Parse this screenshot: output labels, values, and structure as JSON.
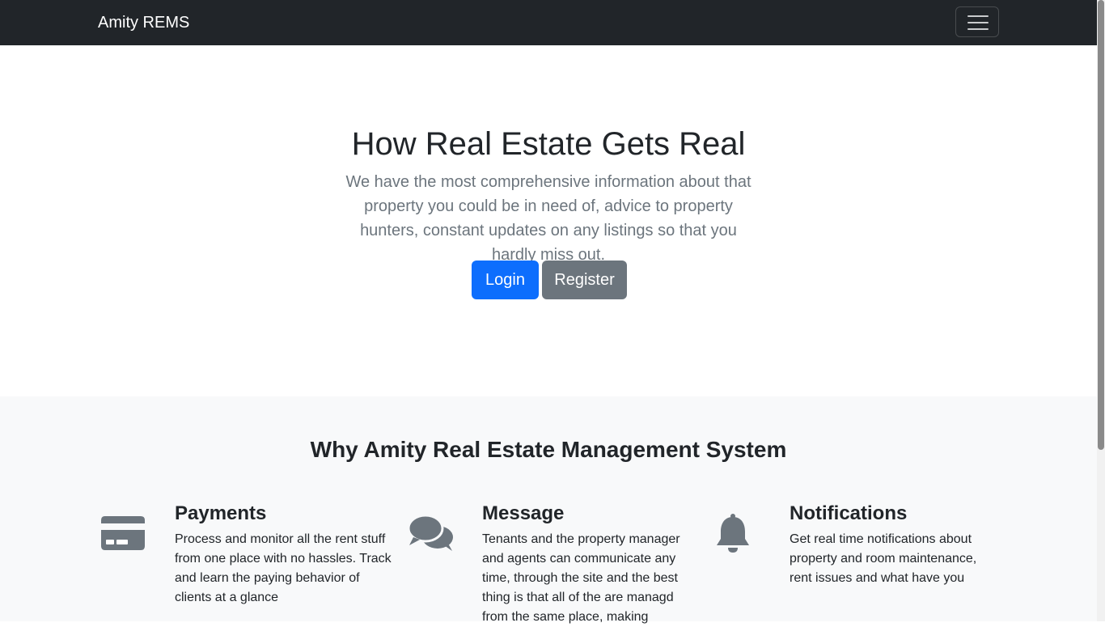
{
  "navbar": {
    "brand": "Amity REMS",
    "toggler_icon": "hamburger-menu-icon"
  },
  "hero": {
    "title": "How Real Estate Gets Real",
    "lead": "We have the most comprehensive information about that property you could be in need of, advice to property hunters, constant updates on any listings so that you hardly miss out.",
    "login_label": "Login",
    "register_label": "Register"
  },
  "features": {
    "heading": "Why Amity Real Estate Management System",
    "items": [
      {
        "icon": "credit-card-icon",
        "title": "Payments",
        "text": "Process and monitor all the rent stuff from one place with no hassles. Track and learn the paying behavior of clients at a glance"
      },
      {
        "icon": "chat-bubbles-icon",
        "title": "Message",
        "text": "Tenants and the property manager and agents can communicate any time, through the site and the best thing is that all of the are managd from the same place, making"
      },
      {
        "icon": "bell-icon",
        "title": "Notifications",
        "text": "Get real time notifications about property and room maintenance, rent issues and what have you"
      }
    ]
  },
  "colors": {
    "navbar_bg": "#212529",
    "primary": "#0d6efd",
    "secondary": "#6c757d",
    "icon_gray": "#6c757d",
    "features_bg": "#f8f9fa"
  }
}
